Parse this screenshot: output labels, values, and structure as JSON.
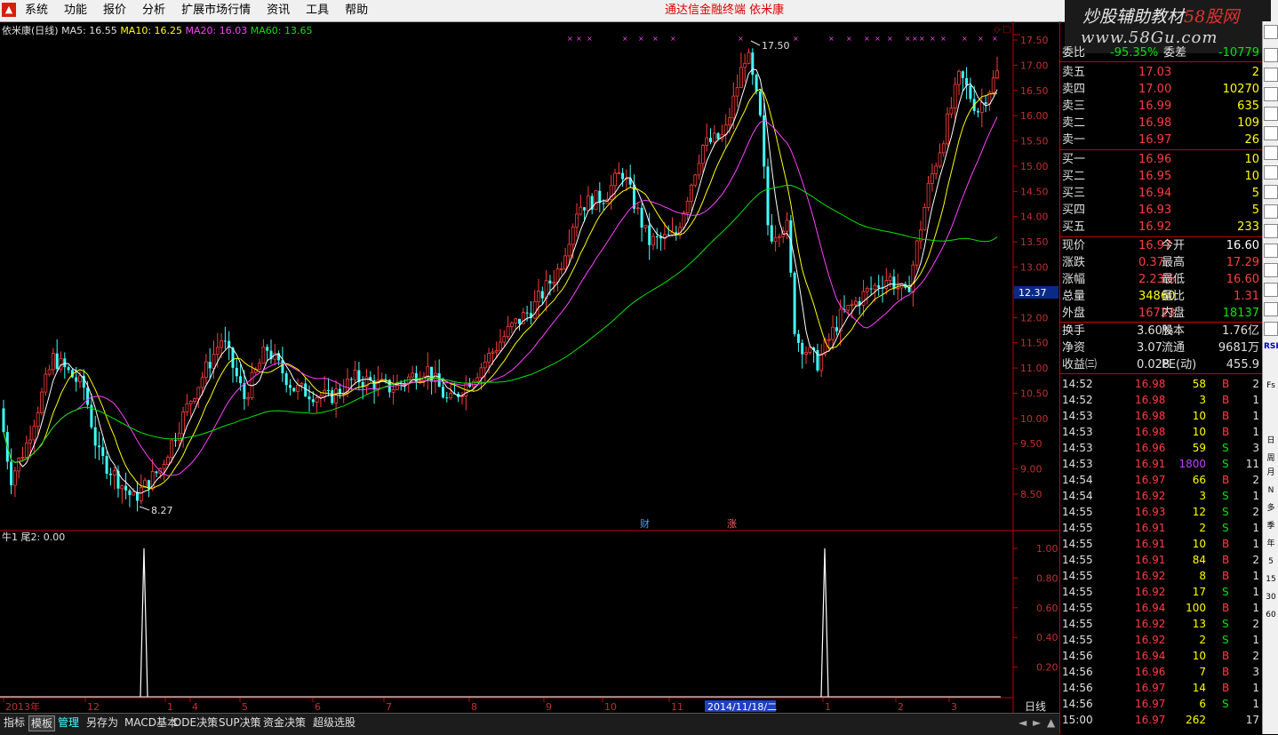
{
  "menu": {
    "items": [
      "系统",
      "功能",
      "报价",
      "分析",
      "扩展市场行情",
      "资讯",
      "工具",
      "帮助"
    ],
    "app_title": "通达信金融终端   依米康"
  },
  "watermark": {
    "line1a": "炒股辅助教材",
    "line1b": "58股网",
    "line2": "www.58Gu.com"
  },
  "chart": {
    "stock_title": "依米康(日线)",
    "ma5": "MA5: 16.55",
    "ma10": "MA10: 16.25",
    "ma20": "MA20: 16.03",
    "ma60": "MA60: 13.65",
    "high_marker": "17.50",
    "low_marker": "8.27",
    "current_price_badge": "12.37",
    "event_cai": "财",
    "event_zhang": "涨",
    "price_axis": [
      "17.50",
      "17.00",
      "16.50",
      "16.00",
      "15.50",
      "15.00",
      "14.50",
      "14.00",
      "13.50",
      "13.00",
      "12.50",
      "12.00",
      "11.50",
      "11.00",
      "10.50",
      "10.00",
      "9.50",
      "9.00",
      "8.50"
    ],
    "sub_title": "牛1  尾2: 0.00",
    "sub_axis": [
      "1.00",
      "0.80",
      "0.60",
      "0.40",
      "0.20"
    ],
    "date_axis": [
      {
        "label": "2013年"
      },
      {
        "label": "12"
      },
      {
        "label": "1"
      },
      {
        "label": "4"
      },
      {
        "label": "5"
      },
      {
        "label": "6"
      },
      {
        "label": "7"
      },
      {
        "label": "8"
      },
      {
        "label": "9"
      },
      {
        "label": "10"
      },
      {
        "label": "11"
      },
      {
        "label": "1"
      },
      {
        "label": "2"
      },
      {
        "label": "3"
      }
    ],
    "cursor_date": "2014/11/18/二",
    "period_label": "日线"
  },
  "quote": {
    "weibi": {
      "label": "委比",
      "value": "-95.35%",
      "label2": "委差",
      "value2": "-10779"
    },
    "asks": [
      {
        "label": "卖五",
        "price": "17.03",
        "vol": "2"
      },
      {
        "label": "卖四",
        "price": "17.00",
        "vol": "10270"
      },
      {
        "label": "卖三",
        "price": "16.99",
        "vol": "635"
      },
      {
        "label": "卖二",
        "price": "16.98",
        "vol": "109"
      },
      {
        "label": "卖一",
        "price": "16.97",
        "vol": "26"
      }
    ],
    "bids": [
      {
        "label": "买一",
        "price": "16.96",
        "vol": "10"
      },
      {
        "label": "买二",
        "price": "16.95",
        "vol": "10"
      },
      {
        "label": "买三",
        "price": "16.94",
        "vol": "5"
      },
      {
        "label": "买四",
        "price": "16.93",
        "vol": "5"
      },
      {
        "label": "买五",
        "price": "16.92",
        "vol": "233"
      }
    ],
    "stats": [
      {
        "l1": "现价",
        "v1": "16.97",
        "l2": "今开",
        "v2": "16.60"
      },
      {
        "l1": "涨跌",
        "v1": "0.37",
        "l2": "最高",
        "v2": "17.29"
      },
      {
        "l1": "涨幅",
        "v1": "2.23%",
        "l2": "最低",
        "v2": "16.60"
      },
      {
        "l1": "总量",
        "v1": "34860",
        "l2": "量比",
        "v2": "1.31"
      },
      {
        "l1": "外盘",
        "v1": "16723",
        "l2": "内盘",
        "v2": "18137"
      }
    ],
    "stats2": [
      {
        "l1": "换手",
        "v1": "3.60%",
        "l2": "股本",
        "v2": "1.76亿"
      },
      {
        "l1": "净资",
        "v1": "3.07",
        "l2": "流通",
        "v2": "9681万"
      },
      {
        "l1": "收益㈢",
        "v1": "0.028",
        "l2": "PE(动)",
        "v2": "455.9"
      }
    ],
    "ticks": [
      {
        "t": "14:52",
        "p": "16.98",
        "v": "58",
        "bs": "B",
        "n": "2"
      },
      {
        "t": "14:52",
        "p": "16.98",
        "v": "3",
        "bs": "B",
        "n": "1"
      },
      {
        "t": "14:53",
        "p": "16.98",
        "v": "10",
        "bs": "B",
        "n": "1"
      },
      {
        "t": "14:53",
        "p": "16.98",
        "v": "10",
        "bs": "B",
        "n": "1"
      },
      {
        "t": "14:53",
        "p": "16.96",
        "v": "59",
        "bs": "S",
        "n": "3"
      },
      {
        "t": "14:53",
        "p": "16.91",
        "v": "1800",
        "bs": "S",
        "n": "11"
      },
      {
        "t": "14:54",
        "p": "16.97",
        "v": "66",
        "bs": "B",
        "n": "2"
      },
      {
        "t": "14:54",
        "p": "16.92",
        "v": "3",
        "bs": "S",
        "n": "1"
      },
      {
        "t": "14:55",
        "p": "16.93",
        "v": "12",
        "bs": "S",
        "n": "2"
      },
      {
        "t": "14:55",
        "p": "16.91",
        "v": "2",
        "bs": "S",
        "n": "1"
      },
      {
        "t": "14:55",
        "p": "16.91",
        "v": "10",
        "bs": "B",
        "n": "1"
      },
      {
        "t": "14:55",
        "p": "16.91",
        "v": "84",
        "bs": "B",
        "n": "2"
      },
      {
        "t": "14:55",
        "p": "16.92",
        "v": "8",
        "bs": "B",
        "n": "1"
      },
      {
        "t": "14:55",
        "p": "16.92",
        "v": "17",
        "bs": "S",
        "n": "1"
      },
      {
        "t": "14:55",
        "p": "16.94",
        "v": "100",
        "bs": "B",
        "n": "1"
      },
      {
        "t": "14:55",
        "p": "16.92",
        "v": "13",
        "bs": "S",
        "n": "2"
      },
      {
        "t": "14:55",
        "p": "16.92",
        "v": "2",
        "bs": "S",
        "n": "1"
      },
      {
        "t": "14:56",
        "p": "16.94",
        "v": "10",
        "bs": "B",
        "n": "2"
      },
      {
        "t": "14:56",
        "p": "16.96",
        "v": "7",
        "bs": "B",
        "n": "3"
      },
      {
        "t": "14:56",
        "p": "16.97",
        "v": "14",
        "bs": "B",
        "n": "1"
      },
      {
        "t": "14:56",
        "p": "16.97",
        "v": "6",
        "bs": "S",
        "n": "1"
      },
      {
        "t": "15:00",
        "p": "16.97",
        "v": "262",
        "bs": "",
        "n": "17"
      }
    ]
  },
  "right_toolbar": [
    "RSI",
    "Fs",
    "日",
    "周",
    "月",
    "N",
    "多",
    "季",
    "年",
    "5",
    "15",
    "30",
    "60"
  ],
  "tabs": [
    "指标",
    "模板",
    "管理",
    "另存为",
    "MACD基本",
    "DDE决策",
    "SUP决策",
    "资金决策",
    "超级选股"
  ],
  "colors": {
    "up": "#ff3c3c",
    "down": "#40ffff",
    "ma5": "#ffffff",
    "ma10": "#ffff00",
    "ma20": "#ff40ff",
    "ma60": "#00e600",
    "grid": "#c00000"
  }
}
